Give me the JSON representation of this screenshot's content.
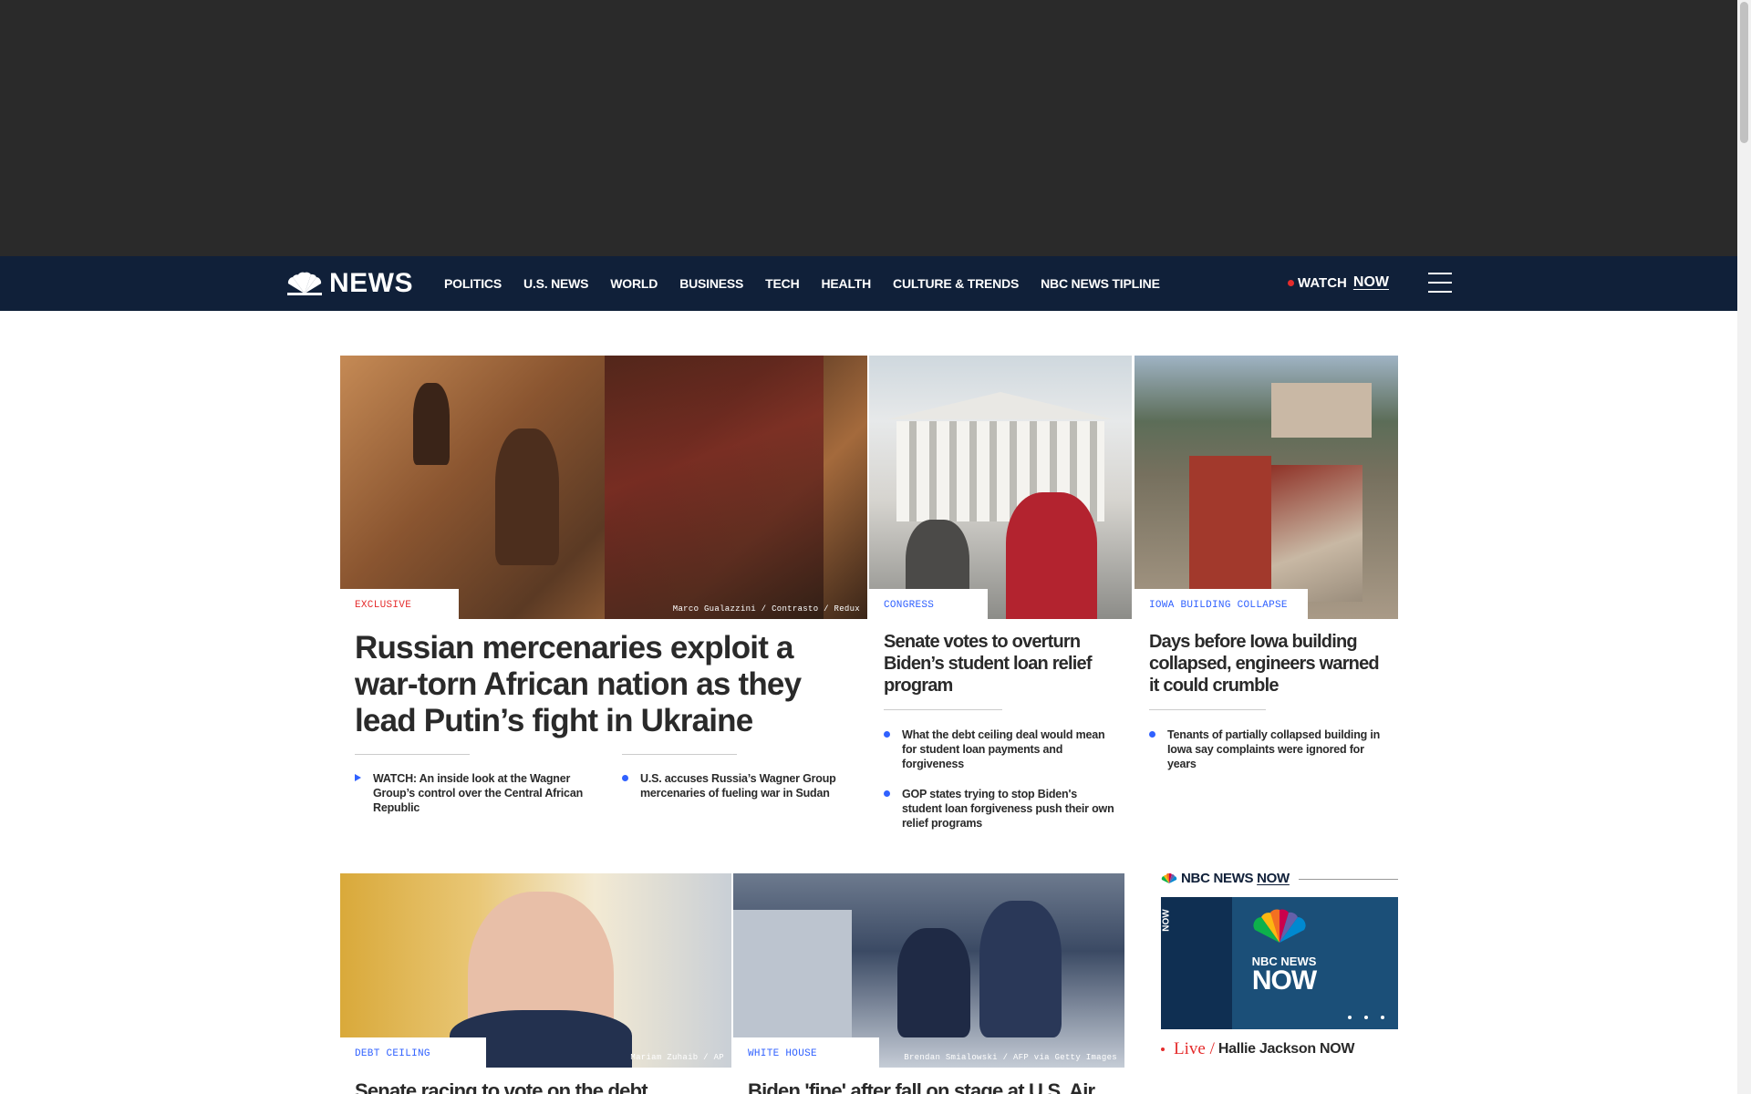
{
  "brand": {
    "logo_text": "NEWS",
    "accent": "#102039",
    "link_blue": "#3061ff",
    "alert_red": "#e52c2c"
  },
  "nav": {
    "items": [
      "POLITICS",
      "U.S. NEWS",
      "WORLD",
      "BUSINESS",
      "TECH",
      "HEALTH",
      "CULTURE & TRENDS",
      "NBC NEWS TIPLINE"
    ],
    "watch_label": "WATCH",
    "watch_now": "NOW",
    "menu_icon": "hamburger-icon"
  },
  "lead": {
    "tag": "EXCLUSIVE",
    "credit": "Marco Gualazzini / Contrasto / Redux",
    "headline": "Russian mercenaries exploit a war-torn African nation as they lead Putin’s fight in Ukraine",
    "related": [
      "WATCH: An inside look at the Wagner Group’s control over the Central African Republic",
      "U.S. accuses Russia’s Wagner Group mercenaries of fueling war in Sudan"
    ]
  },
  "story2": {
    "tag": "CONGRESS",
    "headline": "Senate votes to overturn Biden’s student loan relief program",
    "related": [
      "What the debt ceiling deal would mean for student loan payments and forgiveness",
      "GOP states trying to stop Biden's student loan forgiveness push their own relief programs"
    ]
  },
  "story3": {
    "tag": "IOWA BUILDING COLLAPSE",
    "headline": "Days before Iowa building collapsed, engineers warned it could crumble",
    "related": [
      "Tenants of partially collapsed building in Iowa say complaints were ignored for years"
    ]
  },
  "story4": {
    "tag": "DEBT CEILING",
    "credit": "Mariam Zuhaib / AP",
    "headline": "Senate racing to vote on the debt"
  },
  "story5": {
    "tag": "WHITE HOUSE",
    "credit": "Brendan Smialowski / AFP via Getty Images",
    "headline": "Biden 'fine' after fall on stage at U.S. Air"
  },
  "now_widget": {
    "header_prefix": "NBC NEWS",
    "header_now": "NOW",
    "thumb_side_label": "NOW",
    "thumb_logo_line1": "NBC NEWS",
    "thumb_logo_line2": "NOW",
    "live_label": "Live /",
    "show_name": "Hallie Jackson NOW"
  }
}
